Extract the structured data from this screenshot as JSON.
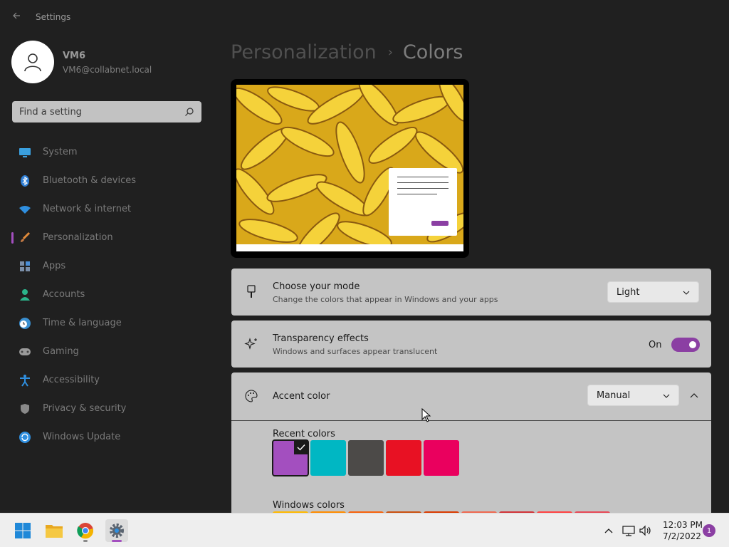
{
  "window": {
    "app_title": "Settings"
  },
  "user": {
    "name": "VM6",
    "email": "VM6@collabnet.local"
  },
  "search": {
    "placeholder": "Find a setting",
    "value": ""
  },
  "sidebar": {
    "items": [
      {
        "label": "System",
        "icon": "monitor-icon"
      },
      {
        "label": "Bluetooth & devices",
        "icon": "bluetooth-icon"
      },
      {
        "label": "Network & internet",
        "icon": "wifi-icon"
      },
      {
        "label": "Personalization",
        "icon": "paintbrush-icon",
        "active": true
      },
      {
        "label": "Apps",
        "icon": "apps-icon"
      },
      {
        "label": "Accounts",
        "icon": "person-icon"
      },
      {
        "label": "Time & language",
        "icon": "clock-globe-icon"
      },
      {
        "label": "Gaming",
        "icon": "gamepad-icon"
      },
      {
        "label": "Accessibility",
        "icon": "accessibility-icon"
      },
      {
        "label": "Privacy & security",
        "icon": "shield-icon"
      },
      {
        "label": "Windows Update",
        "icon": "refresh-icon"
      }
    ]
  },
  "header": {
    "parent": "Personalization",
    "separator": "›",
    "current": "Colors"
  },
  "mode": {
    "title": "Choose your mode",
    "description": "Change the colors that appear in Windows and your apps",
    "value": "Light"
  },
  "transparency": {
    "title": "Transparency effects",
    "description": "Windows and surfaces appear translucent",
    "state": "On",
    "enabled": true
  },
  "accent": {
    "title": "Accent color",
    "value": "Manual",
    "recent_label": "Recent colors",
    "recent_colors": [
      "#a34fbf",
      "#00b7c3",
      "#4c4a48",
      "#e81123",
      "#ea005e"
    ],
    "selected_index": 0,
    "windows_colors_label": "Windows colors",
    "windows_colors": [
      "#ffb900",
      "#ff8c00",
      "#f7630c",
      "#ca5010",
      "#da3b01",
      "#ef6950",
      "#d13438",
      "#ff4343",
      "#e74856"
    ]
  },
  "colors": {
    "accent": "#a34fbf",
    "background": "#202020",
    "card": "#c4c4c4"
  },
  "taskbar": {
    "apps": [
      "start-icon",
      "file-explorer-icon",
      "chrome-icon",
      "settings-icon"
    ],
    "time": "12:03 PM",
    "date": "7/2/2022",
    "notification_count": "1"
  }
}
